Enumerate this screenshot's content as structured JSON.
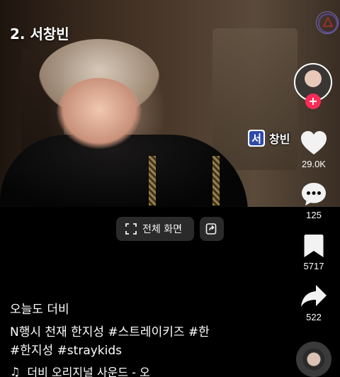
{
  "video": {
    "title": "2. 서창빈",
    "sticker_icon_char": "서",
    "sticker_label": "창빈"
  },
  "actions": {
    "likes": "29.0K",
    "comments": "125",
    "saves": "5717",
    "shares": "522"
  },
  "controls": {
    "fullscreen_label": "전체 화면"
  },
  "caption": {
    "username": "오늘도  더비",
    "line1": "N행시 천재 한지성 #스트레이키즈 #한",
    "line2": "#한지성 #straykids"
  },
  "music": {
    "note_icon": "music-note-icon",
    "text": "더비   오리지널 사운드 - 오"
  },
  "colors": {
    "follow": "#fe2c55",
    "sticker_blue": "#2f4aa8",
    "background": "#000000"
  }
}
